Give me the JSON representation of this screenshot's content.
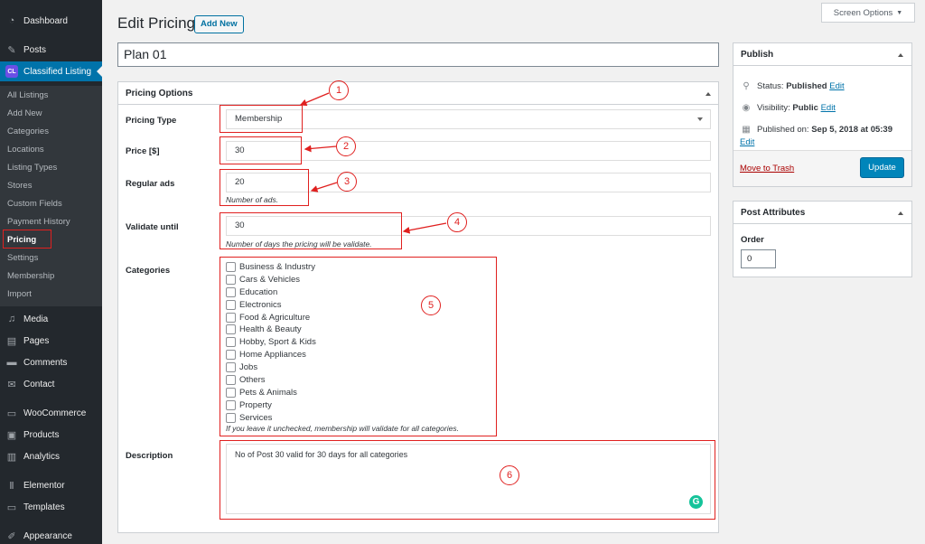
{
  "sidebar": {
    "items": [
      {
        "label": "Dashboard",
        "icon": "dashboard-icon",
        "glyph": "◔"
      },
      {
        "label": "Posts",
        "icon": "pin-icon",
        "glyph": "✎"
      },
      {
        "label": "Classified Listing",
        "icon": "cl-logo-icon",
        "glyph": "CL"
      }
    ],
    "submenu": [
      "All Listings",
      "Add New",
      "Categories",
      "Locations",
      "Listing Types",
      "Stores",
      "Custom Fields",
      "Payment History",
      "Pricing",
      "Settings",
      "Membership",
      "Import"
    ],
    "items2": [
      {
        "label": "Media",
        "icon": "media-icon",
        "glyph": "♫"
      },
      {
        "label": "Pages",
        "icon": "pages-icon",
        "glyph": "▤"
      },
      {
        "label": "Comments",
        "icon": "comment-icon",
        "glyph": "▬"
      },
      {
        "label": "Contact",
        "icon": "mail-icon",
        "glyph": "✉"
      },
      {
        "label": "WooCommerce",
        "icon": "woo-icon",
        "glyph": "▭"
      },
      {
        "label": "Products",
        "icon": "box-icon",
        "glyph": "▣"
      },
      {
        "label": "Analytics",
        "icon": "analytics-icon",
        "glyph": "▥"
      },
      {
        "label": "Elementor",
        "icon": "elementor-icon",
        "glyph": "Ⅱ"
      },
      {
        "label": "Templates",
        "icon": "folder-icon",
        "glyph": "▭"
      },
      {
        "label": "Appearance",
        "icon": "brush-icon",
        "glyph": "✐"
      }
    ]
  },
  "header": {
    "title": "Edit Pricing",
    "add_new": "Add New",
    "screen_options": "Screen Options",
    "post_title": "Plan 01"
  },
  "pricing": {
    "box_title": "Pricing Options",
    "type_label": "Pricing Type",
    "type_value": "Membership",
    "price_label": "Price [$]",
    "price_value": "30",
    "ads_label": "Regular ads",
    "ads_value": "20",
    "ads_desc": "Number of ads.",
    "validate_label": "Validate until",
    "validate_value": "30",
    "validate_desc": "Number of days the pricing will be validate.",
    "categories_label": "Categories",
    "categories": [
      "Business & Industry",
      "Cars & Vehicles",
      "Education",
      "Electronics",
      "Food & Agriculture",
      "Health & Beauty",
      "Hobby, Sport & Kids",
      "Home Appliances",
      "Jobs",
      "Others",
      "Pets & Animals",
      "Property",
      "Services"
    ],
    "categories_desc": "If you leave it unchecked, membership will validate for all categories.",
    "description_label": "Description",
    "description_value": "No of Post 30 valid for 30 days for all categories"
  },
  "annotations": [
    "1",
    "2",
    "3",
    "4",
    "5",
    "6"
  ],
  "publish": {
    "title": "Publish",
    "status_label": "Status:",
    "status_value": "Published",
    "visibility_label": "Visibility:",
    "visibility_value": "Public",
    "published_label": "Published on:",
    "published_value": "Sep 5, 2018 at 05:39",
    "edit": "Edit",
    "trash": "Move to Trash",
    "update": "Update"
  },
  "attributes": {
    "title": "Post Attributes",
    "order_label": "Order",
    "order_value": "0"
  },
  "colors": {
    "sidebar": "#23282d",
    "submenu": "#32373c",
    "active": "#0073aa",
    "annotation": "#e0201f",
    "update_button": "#0085ba"
  }
}
